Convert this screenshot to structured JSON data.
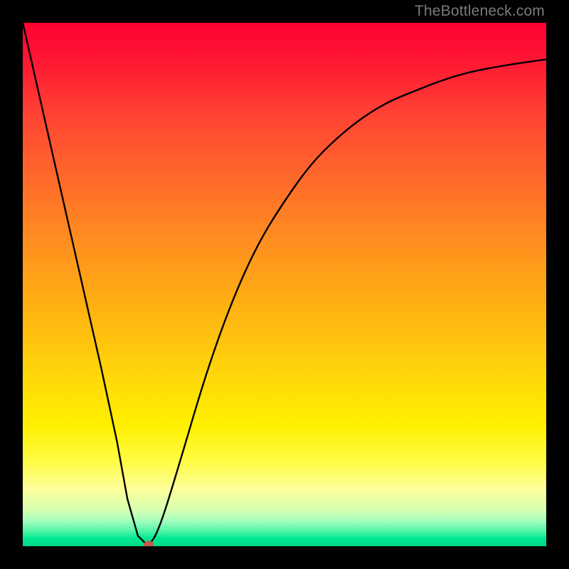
{
  "watermark": "TheBottleneck.com",
  "colors": {
    "frame": "#000000",
    "curve": "#000000",
    "marker": "#c1594a",
    "gradient_top": "#ff0033",
    "gradient_mid": "#ffd60a",
    "gradient_bottom": "#00d885"
  },
  "chart_data": {
    "type": "line",
    "title": "",
    "xlabel": "",
    "ylabel": "",
    "xlim": [
      0,
      100
    ],
    "ylim": [
      0,
      100
    ],
    "grid": false,
    "legend": false,
    "series": [
      {
        "name": "bottleneck-curve",
        "x": [
          0,
          5,
          10,
          15,
          18,
          20,
          22,
          24,
          26,
          30,
          35,
          40,
          45,
          50,
          55,
          60,
          65,
          70,
          75,
          80,
          85,
          90,
          95,
          100
        ],
        "values": [
          100,
          78,
          56,
          34,
          20,
          9,
          2,
          0,
          3,
          16,
          33,
          47,
          58,
          66,
          73,
          78,
          82,
          85,
          87,
          89,
          90.5,
          91.5,
          92.3,
          93
        ]
      }
    ],
    "annotations": [
      {
        "type": "marker",
        "x": 24,
        "y": 0,
        "color": "#c1594a",
        "shape": "ellipse"
      }
    ]
  }
}
